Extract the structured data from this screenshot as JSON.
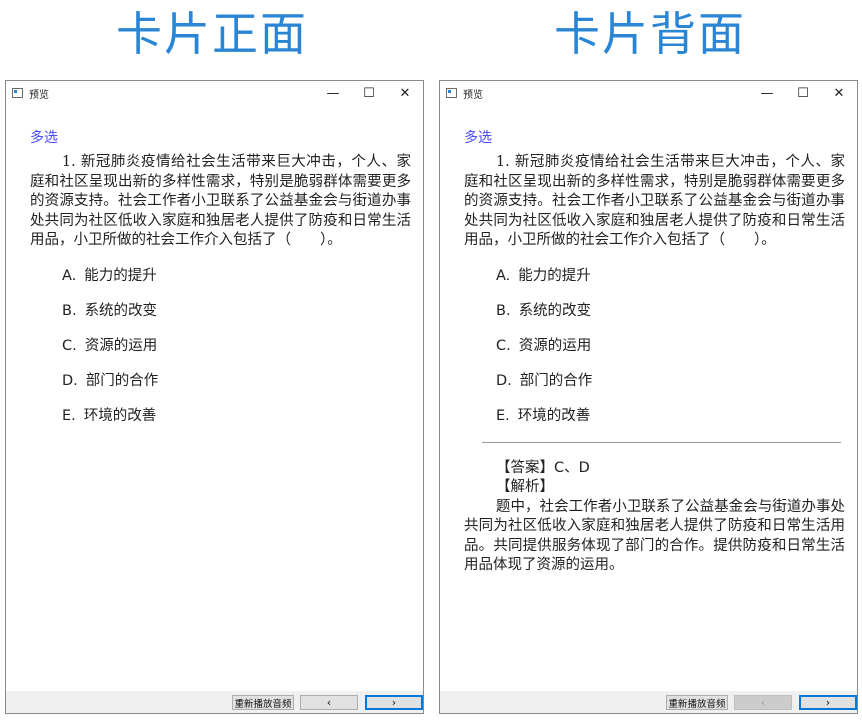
{
  "headings": {
    "front": "卡片正面",
    "back": "卡片背面"
  },
  "window_title": "预览",
  "window_controls": {
    "minimize": "—",
    "maximize": "☐",
    "close": "✕"
  },
  "question": {
    "type": "多选",
    "stem": "1. 新冠肺炎疫情给社会生活带来巨大冲击，个人、家庭和社区呈现出新的多样性需求，特别是脆弱群体需要更多的资源支持。社会工作者小卫联系了公益基金会与街道办事处共同为社区低收入家庭和独居老人提供了防疫和日常生活用品，小卫所做的社会工作介入包括了（　　）。",
    "options": [
      {
        "letter": "A.",
        "text": "能力的提升"
      },
      {
        "letter": "B.",
        "text": "系统的改变"
      },
      {
        "letter": "C.",
        "text": "资源的运用"
      },
      {
        "letter": "D.",
        "text": "部门的合作"
      },
      {
        "letter": "E.",
        "text": "环境的改善"
      }
    ]
  },
  "answer": {
    "label": "【答案】",
    "value": "C、D",
    "analysis_label": "【解析】",
    "analysis": "题中，社会工作者小卫联系了公益基金会与街道办事处共同为社区低收入家庭和独居老人提供了防疫和日常生活用品。共同提供服务体现了部门的合作。提供防疫和日常生活用品体现了资源的运用。"
  },
  "buttons": {
    "replay": "重新播放音频",
    "prev": "‹",
    "next": "›"
  },
  "colors": {
    "heading": "#2a86d4",
    "qtype": "#4b4bff",
    "focus_border": "#0078d7"
  }
}
